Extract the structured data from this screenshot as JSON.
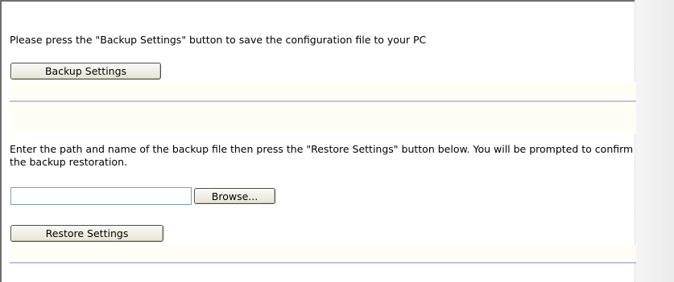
{
  "backup": {
    "instruction": "Please press the \"Backup Settings\" button to save the configuration file to your PC",
    "button_label": "Backup Settings"
  },
  "restore": {
    "instruction": "Enter the path and name of the backup file then press the \"Restore Settings\" button below. You will be prompted to confirm the backup restoration.",
    "file_value": "",
    "browse_label": "Browse...",
    "button_label": "Restore Settings"
  },
  "colors": {
    "divider": "#c3c0e0",
    "section_background": "#fffdf6",
    "page_background": "#ffffff"
  }
}
